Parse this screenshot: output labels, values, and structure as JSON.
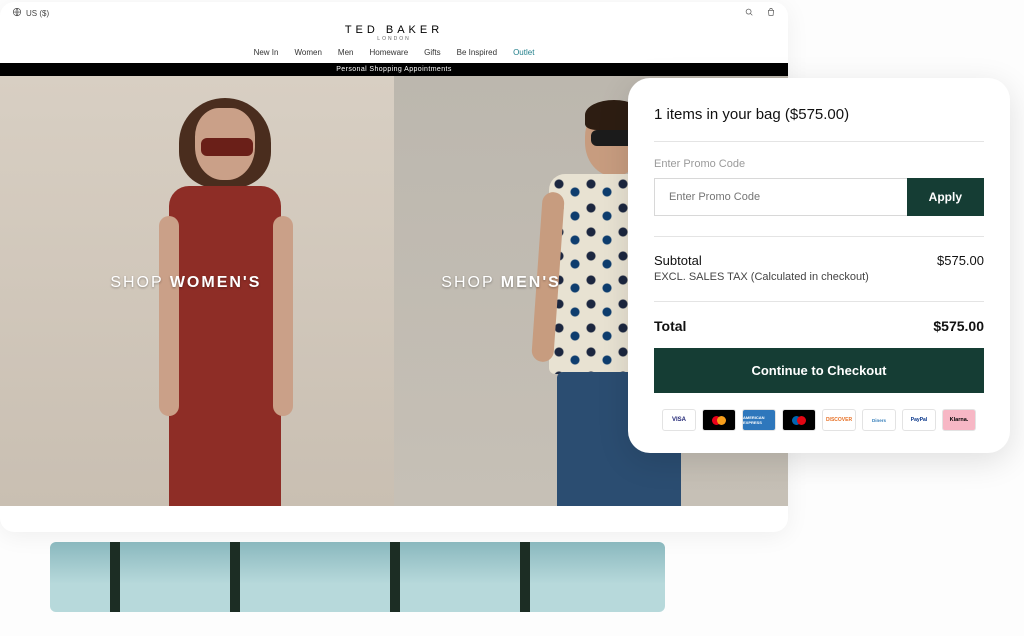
{
  "region": "US ($)",
  "brand": {
    "name": "TED BAKER",
    "sub": "LONDON"
  },
  "nav": {
    "items": [
      "New In",
      "Women",
      "Men",
      "Homeware",
      "Gifts",
      "Be Inspired"
    ],
    "outlet": "Outlet"
  },
  "banner": "Personal Shopping Appointments",
  "hero": {
    "women_light": "SHOP ",
    "women_bold": "WOMEN'S",
    "men_light": "SHOP ",
    "men_bold": "MEN'S"
  },
  "cart": {
    "title": "1 items in your bag ($575.00)",
    "promo_label": "Enter Promo Code",
    "promo_placeholder": "Enter Promo Code",
    "apply": "Apply",
    "subtotal_label": "Subtotal",
    "subtotal_value": "$575.00",
    "tax_note": "EXCL. SALES TAX (Calculated in checkout)",
    "total_label": "Total",
    "total_value": "$575.00",
    "checkout": "Continue to Checkout",
    "payments": {
      "visa": "VISA",
      "amex": "AMERICAN EXPRESS",
      "discover": "DISCOVER",
      "diners": "Diners",
      "paypal": "PayPal",
      "klarna": "Klarna."
    }
  }
}
